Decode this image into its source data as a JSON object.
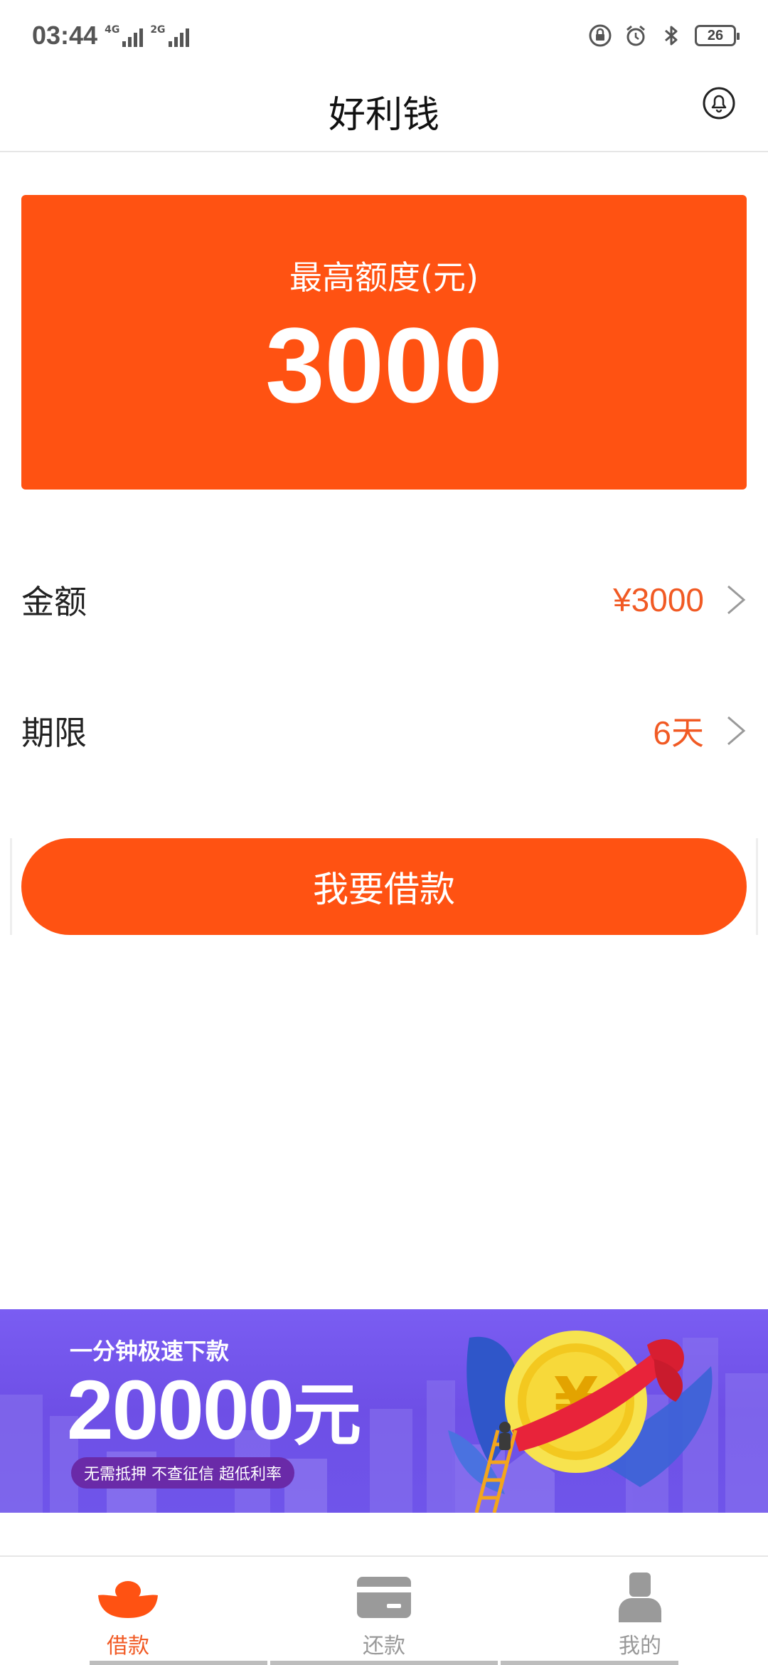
{
  "status_bar": {
    "time": "03:44",
    "net1_label": "4G",
    "net2_label": "2G",
    "battery": "26",
    "icons": [
      "lock-icon",
      "alarm-icon",
      "bluetooth-icon"
    ]
  },
  "header": {
    "title": "好利钱",
    "bell_icon": "bell-icon"
  },
  "quota": {
    "label": "最高额度(元)",
    "value": "3000"
  },
  "form": {
    "amount_label": "金额",
    "amount_value": "¥3000",
    "term_label": "期限",
    "term_value": "6天"
  },
  "borrow_button": "我要借款",
  "banner": {
    "subtitle": "一分钟极速下款",
    "amount": "20000",
    "unit": "元",
    "tagline": "无需抵押 不查征信 超低利率",
    "coin_symbol": "¥"
  },
  "tabs": [
    {
      "label": "借款",
      "icon": "ingot-icon",
      "active": true
    },
    {
      "label": "还款",
      "icon": "card-icon",
      "active": false
    },
    {
      "label": "我的",
      "icon": "user-icon",
      "active": false
    }
  ],
  "colors": {
    "accent": "#ff5212",
    "accent_text": "#f15a24",
    "banner": "#7a5df2"
  }
}
